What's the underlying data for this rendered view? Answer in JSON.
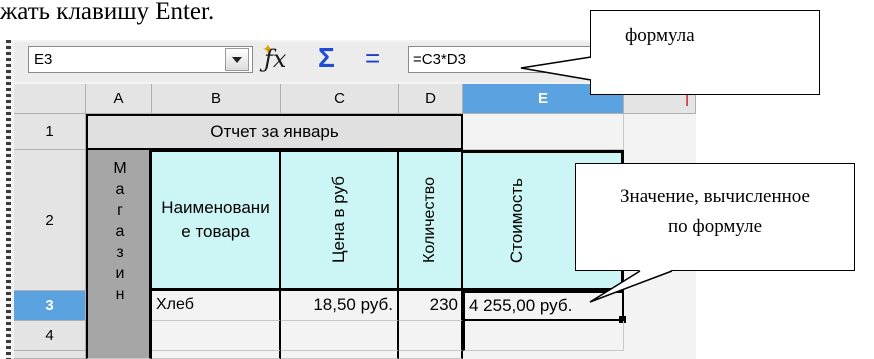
{
  "doc_text": "жать клавишу Enter.",
  "formula_bar": {
    "name_box": "E3",
    "function_wizard_icon": "fx-icon",
    "sum_icon": "sum-icon",
    "equals_icon": "equals-icon",
    "formula": "=C3*D3"
  },
  "callouts": {
    "formula": "формула",
    "value_line1": "Значение, вычисленное",
    "value_line2": "по формуле"
  },
  "grid": {
    "columns": [
      "A",
      "B",
      "C",
      "D",
      "E"
    ],
    "rows": [
      "1",
      "2",
      "3",
      "4"
    ],
    "title": "Отчет за январь",
    "vertical_header": "Магазин",
    "headers": {
      "product": "Наименование товара",
      "price": "Цена в руб",
      "quantity": "Количество",
      "cost": "Стоимость"
    },
    "row3": {
      "product": "Хлеб",
      "price": "18,50 руб.",
      "quantity": "230",
      "cost": "4 255,00 руб."
    }
  },
  "colors": {
    "header_fill": "#ccf6f6",
    "selected_column": "#5aa2e0",
    "grid_border": "#000000"
  }
}
